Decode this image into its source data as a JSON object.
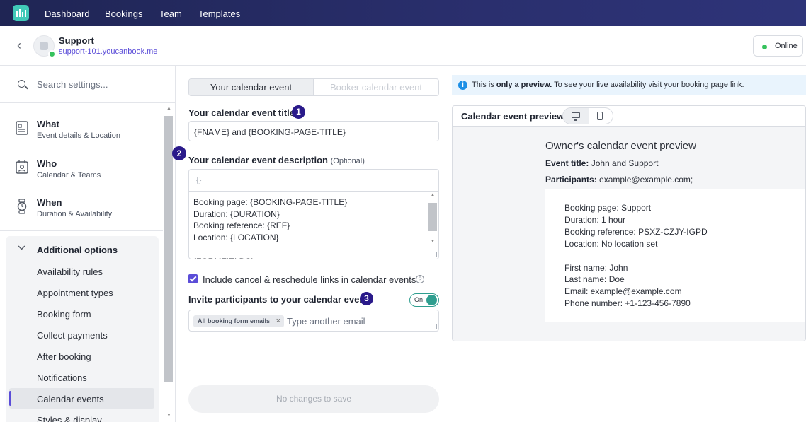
{
  "nav": {
    "items": [
      "Dashboard",
      "Bookings",
      "Team",
      "Templates"
    ]
  },
  "header": {
    "name": "Support",
    "url": "support-101.youcanbook.me",
    "status_label": "Online"
  },
  "sidebar": {
    "search_placeholder": "Search settings...",
    "sections": [
      {
        "title": "What",
        "subtitle": "Event details & Location",
        "icon": "document-icon"
      },
      {
        "title": "Who",
        "subtitle": "Calendar & Teams",
        "icon": "contact-card-icon"
      },
      {
        "title": "When",
        "subtitle": "Duration & Availability",
        "icon": "watch-icon"
      }
    ],
    "additional": {
      "title": "Additional options",
      "items": [
        "Availability rules",
        "Appointment types",
        "Booking form",
        "Collect payments",
        "After booking",
        "Notifications",
        "Calendar events",
        "Styles & display"
      ],
      "active_item": "Calendar events"
    }
  },
  "form": {
    "tabs": [
      "Your calendar event",
      "Booker calendar event"
    ],
    "title_label": "Your calendar event title",
    "title_value": "{FNAME} and {BOOKING-PAGE-TITLE}",
    "desc_label": "Your calendar event description",
    "desc_optional": "(Optional)",
    "desc_toolbar": "{}",
    "desc_value": "Booking page: {BOOKING-PAGE-TITLE}\nDuration: {DURATION}\nBooking reference: {REF}\nLocation: {LOCATION}\n\n{FORMFIELDS}",
    "include_links_label": "Include cancel & reschedule links in calendar events",
    "include_links_checked": true,
    "help_glyph": "?",
    "invite_label": "Invite participants to your calendar event",
    "invite_toggle_label": "On",
    "invite_toggle_on": true,
    "invite_chip": "All booking form emails",
    "invite_placeholder": "Type another email",
    "save_label": "No changes to save",
    "badges": [
      "1",
      "2",
      "3"
    ]
  },
  "preview": {
    "info_prefix": "This is ",
    "info_bold": "only a preview.",
    "info_middle": " To see your live availability visit your ",
    "info_link": "booking page link",
    "info_suffix": ".",
    "panel_title": "Calendar event preview",
    "heading": "Owner's calendar event preview",
    "event_title_label": "Event title:",
    "event_title_value": "John and Support",
    "participants_label": "Participants:",
    "participants_value": "example@example.com;",
    "body": "Booking page: Support\nDuration: 1 hour\nBooking reference: PSXZ-CZJY-IGPD\nLocation: No location set\n\nFirst name: John\nLast name: Doe\nEmail: example@example.com\nPhone number: +1-123-456-7890"
  },
  "colors": {
    "nav_bg": "#1f2554",
    "accent": "#5b4dd8",
    "badge": "#2a1a8a",
    "toggle_on": "#2f9e8f",
    "online": "#36c25d",
    "info_bg": "#e9f4fd"
  }
}
